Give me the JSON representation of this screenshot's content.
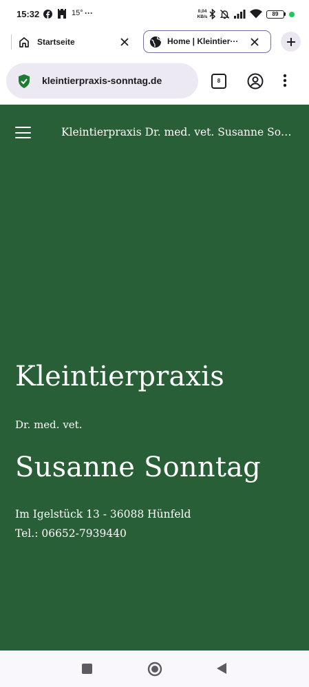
{
  "status_bar": {
    "time": "15:32",
    "temperature": "15°",
    "more": "···",
    "net_speed_value": "0,04",
    "net_speed_unit": "KB/s",
    "battery": "89",
    "icons": [
      "facebook-icon",
      "castle-icon",
      "bluetooth-icon",
      "bell-off-icon",
      "signal-icon",
      "wifi-icon",
      "battery-icon"
    ]
  },
  "browser": {
    "tabs": [
      {
        "label": "Startseite",
        "icon": "home-icon"
      },
      {
        "label": "Home | Kleintier···",
        "icon": "globe-icon",
        "active": true
      }
    ],
    "url": "kleintierpraxis-sonntag.de",
    "tab_count": "8"
  },
  "site": {
    "header_title": "Kleintierpraxis Dr. med. vet. Susanne Son...",
    "heading": "Kleintierpraxis",
    "title": "Dr. med. vet.",
    "name": "Susanne Sonntag",
    "address": "Im Igelstück 13 - 36088 Hünfeld",
    "phone": "Tel.: 06652-7939440",
    "background_color": "#295f36"
  },
  "colors": {
    "site_green": "#295f36",
    "active_tab_border": "#7a6e98",
    "url_pill": "#ece9f2",
    "shield_green": "#1e7b34"
  }
}
